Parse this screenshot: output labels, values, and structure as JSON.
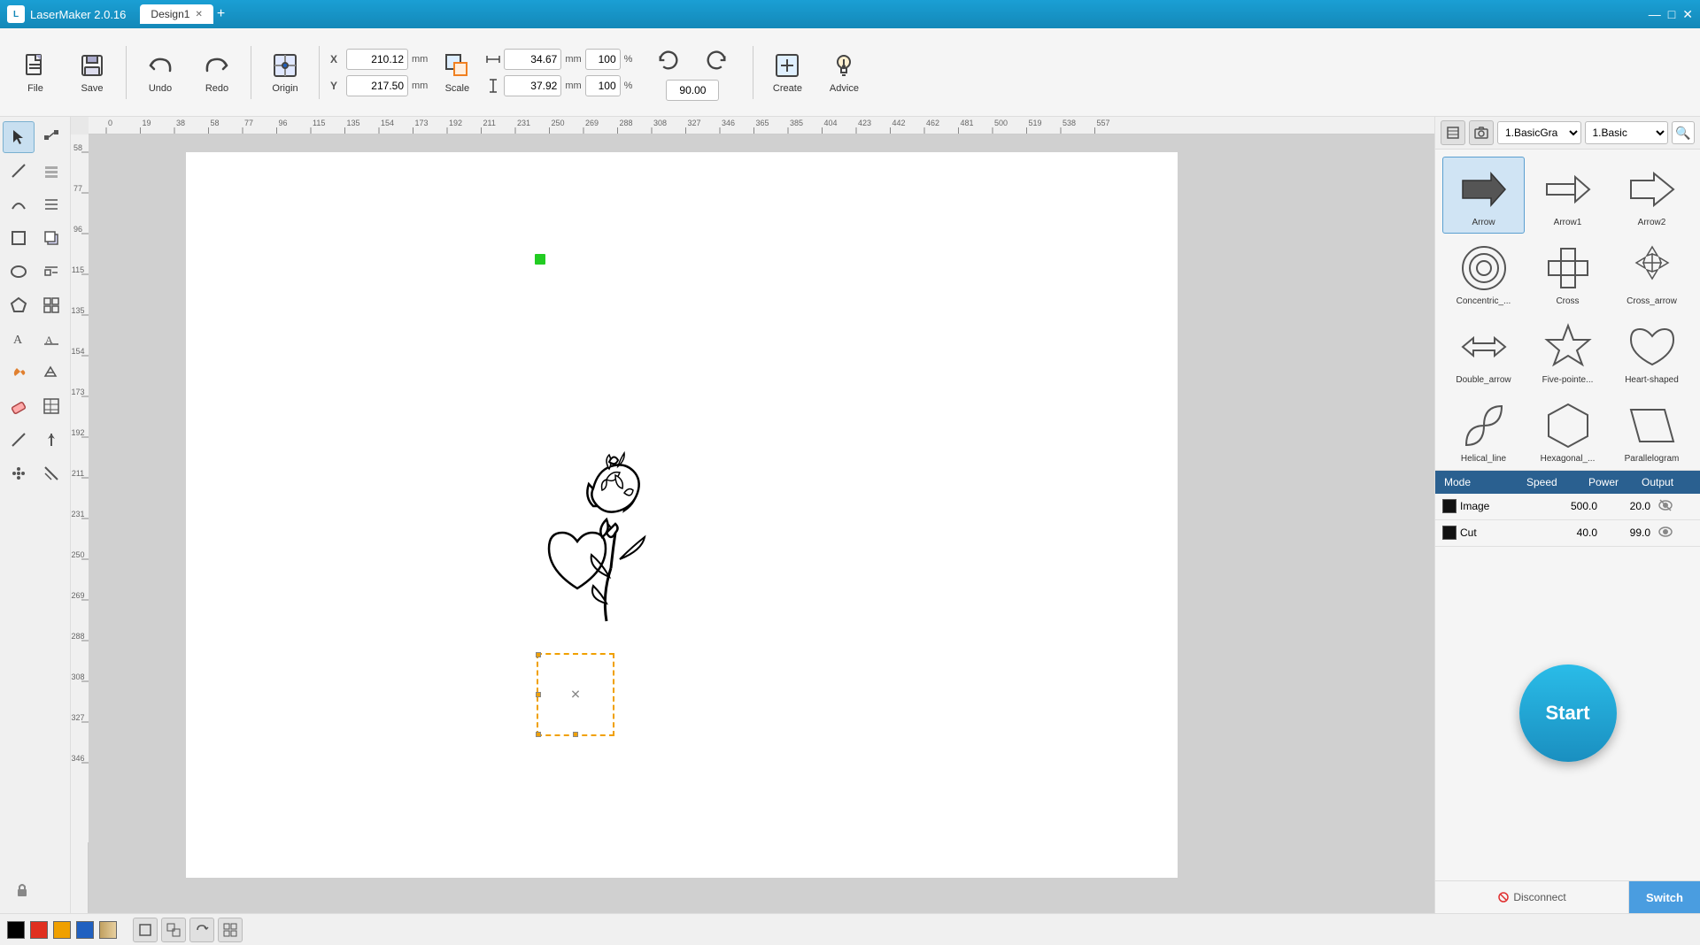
{
  "app": {
    "title": "LaserMaker 2.0.16",
    "tab_name": "Design1",
    "window_min": "—",
    "window_max": "□",
    "window_close": "✕"
  },
  "toolbar": {
    "file_label": "File",
    "save_label": "Save",
    "undo_label": "Undo",
    "redo_label": "Redo",
    "origin_label": "Origin",
    "scale_label": "Scale",
    "create_label": "Create",
    "advice_label": "Advice",
    "x_label": "X",
    "y_label": "Y",
    "x_value": "210.12",
    "y_value": "217.50",
    "x_unit": "mm",
    "y_unit": "mm",
    "w_value": "34.67",
    "h_value": "37.92",
    "w_unit": "mm",
    "h_unit": "mm",
    "w_pct": "100",
    "h_pct": "100",
    "rotation_value": "90.00"
  },
  "shapes": {
    "category": "1.BasicGra",
    "subcategory": "1.Basic",
    "items": [
      {
        "id": "arrow",
        "label": "Arrow",
        "selected": true
      },
      {
        "id": "arrow1",
        "label": "Arrow1",
        "selected": false
      },
      {
        "id": "arrow2",
        "label": "Arrow2",
        "selected": false
      },
      {
        "id": "concentric",
        "label": "Concentric_...",
        "selected": false
      },
      {
        "id": "cross",
        "label": "Cross",
        "selected": false
      },
      {
        "id": "cross_arrow",
        "label": "Cross_arrow",
        "selected": false
      },
      {
        "id": "double_arrow",
        "label": "Double_arrow",
        "selected": false
      },
      {
        "id": "five_pointed",
        "label": "Five-pointe...",
        "selected": false
      },
      {
        "id": "heart",
        "label": "Heart-shaped",
        "selected": false
      },
      {
        "id": "helical_line",
        "label": "Helical_line",
        "selected": false
      },
      {
        "id": "hexagonal",
        "label": "Hexagonal_...",
        "selected": false
      },
      {
        "id": "parallelogram",
        "label": "Parallelogram",
        "selected": false
      }
    ]
  },
  "layers": {
    "headers": [
      "Mode",
      "Speed",
      "Power",
      "Output"
    ],
    "rows": [
      {
        "color": "#111111",
        "name": "Image",
        "speed": "500.0",
        "power": "20.0",
        "visible": true
      },
      {
        "color": "#111111",
        "name": "Cut",
        "speed": "40.0",
        "power": "99.0",
        "visible": true
      }
    ]
  },
  "start_button": "Start",
  "bottom": {
    "disconnect_label": "Disconnect",
    "switch_label": "Switch"
  },
  "colors": {
    "black": "#000000",
    "red": "#e03020",
    "orange": "#f0a000",
    "blue": "#2060c0",
    "gradient": "#d0b080"
  }
}
